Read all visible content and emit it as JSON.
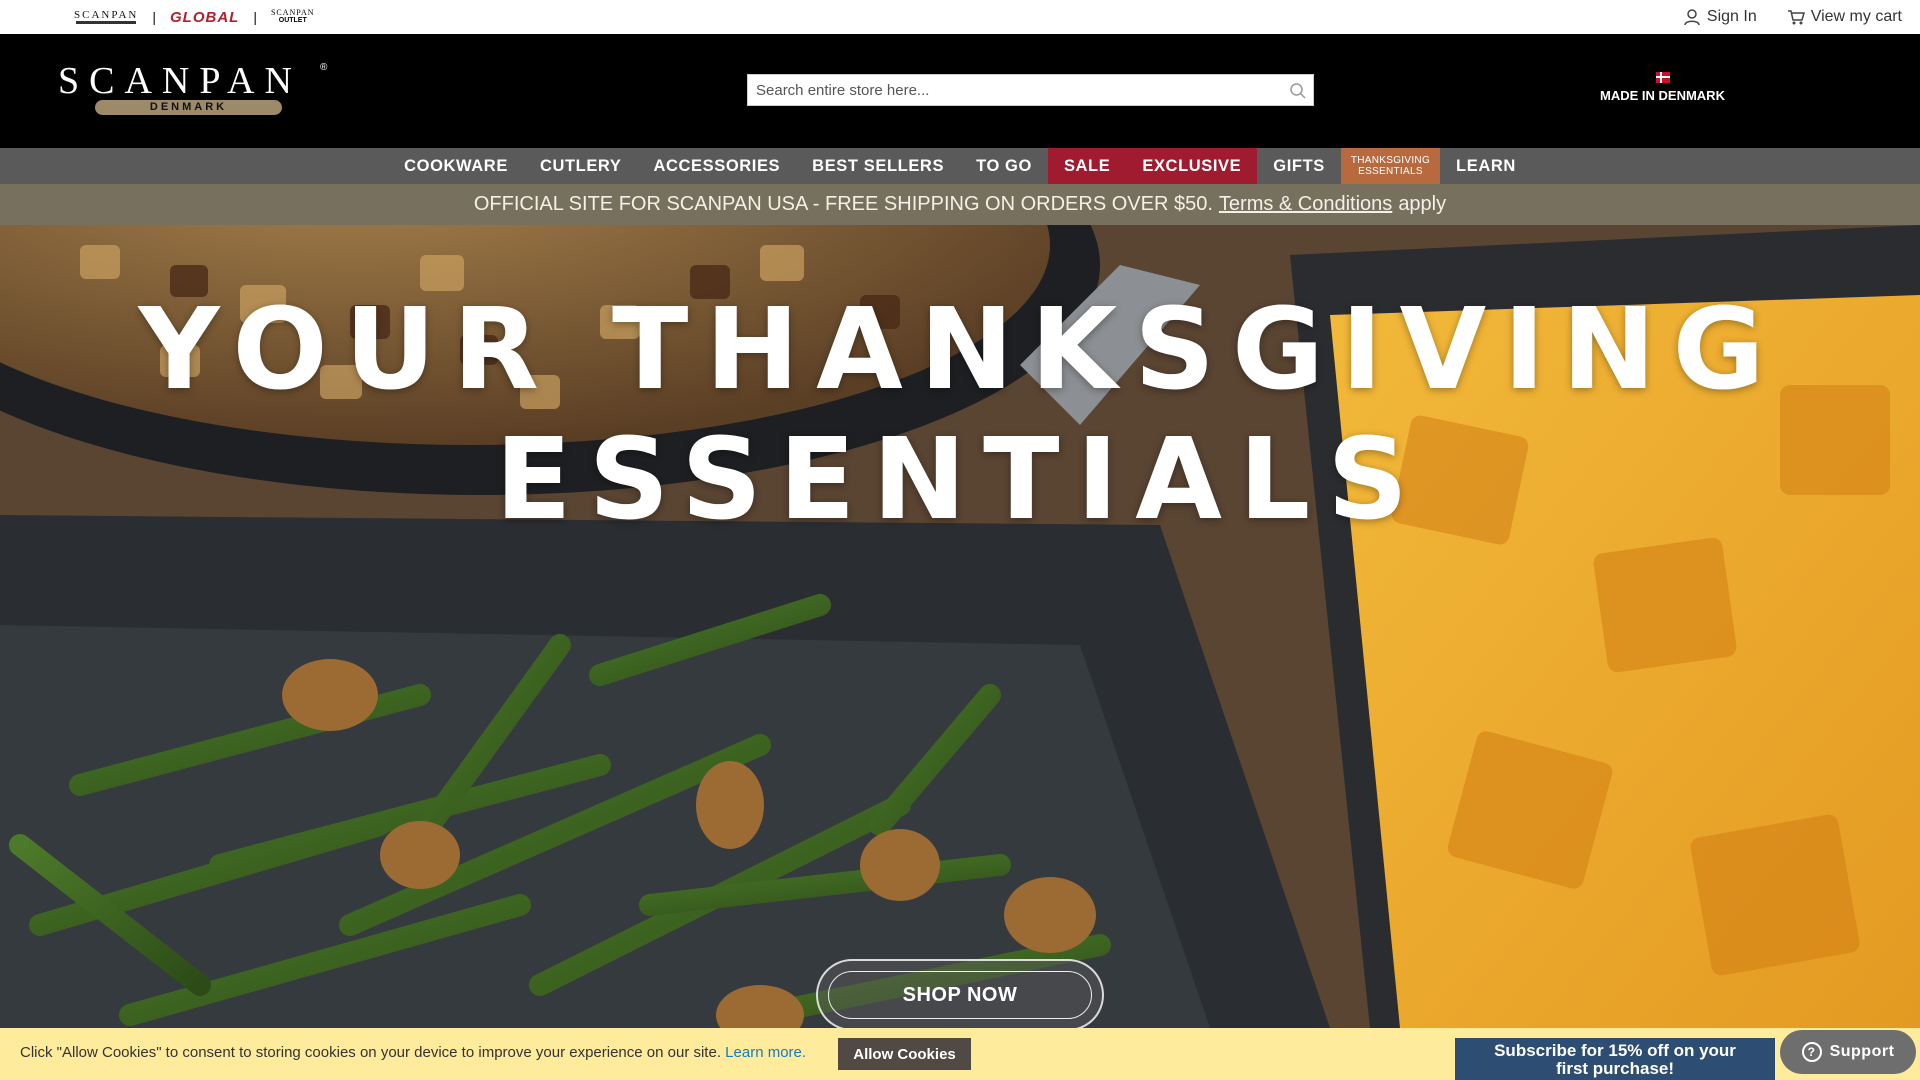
{
  "brands": {
    "scanpan": "SCANPAN",
    "global": "GLOBAL",
    "outlet_top": "SCANPAN",
    "outlet_bottom": "OUTLET",
    "separator": "|"
  },
  "account": {
    "sign_in": "Sign In",
    "cart": "View my cart"
  },
  "header": {
    "logo_text": "SCANPAN",
    "logo_subtitle": "DENMARK",
    "logo_reg": "®",
    "search_placeholder": "Search entire store here...",
    "made_in": "MADE IN DENMARK"
  },
  "nav": {
    "items": [
      {
        "label": "COOKWARE"
      },
      {
        "label": "CUTLERY"
      },
      {
        "label": "ACCESSORIES"
      },
      {
        "label": "BEST SELLERS"
      },
      {
        "label": "TO GO"
      },
      {
        "label": "SALE"
      },
      {
        "label": "EXCLUSIVE"
      },
      {
        "label": "GIFTS"
      },
      {
        "label_line1": "THANKSGIVING",
        "label_line2": "ESSENTIALS"
      },
      {
        "label": "LEARN"
      }
    ]
  },
  "promo": {
    "text": "OFFICIAL SITE FOR SCANPAN USA - FREE SHIPPING ON ORDERS OVER $50.",
    "link": "Terms & Conditions",
    "suffix": "apply"
  },
  "hero": {
    "title_line1": "YOUR THANKSGIVING",
    "title_line2": "ESSENTIALS",
    "cta": "SHOP NOW"
  },
  "cookie": {
    "text": "Click \"Allow Cookies\" to consent to storing cookies on your device to improve your experience on our site.",
    "link": "Learn more.",
    "button": "Allow Cookies"
  },
  "subscribe": {
    "line1": "Subscribe for 15% off on your",
    "line2": "first purchase!"
  },
  "support": {
    "label": "Support",
    "icon": "?"
  },
  "colors": {
    "header_bg": "#000000",
    "nav_bg": "#5a5a5a",
    "nav_sale": "#a01b2f",
    "nav_thanksgiving": "#b86a3e",
    "promo_bg": "#77705f",
    "cookie_bg": "#ffeb9c",
    "subscribe_bg": "#2d4d73"
  }
}
